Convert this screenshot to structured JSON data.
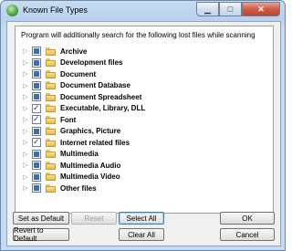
{
  "window": {
    "title": "Known File Types",
    "controls": [
      "minimize-icon",
      "maximize-icon",
      "close-icon"
    ]
  },
  "panel": {
    "description": "Program will additionally search for the following lost files while scanning"
  },
  "tree": {
    "items": [
      {
        "label": "Archive",
        "state": "partial"
      },
      {
        "label": "Development files",
        "state": "partial"
      },
      {
        "label": "Document",
        "state": "partial"
      },
      {
        "label": "Document Database",
        "state": "partial"
      },
      {
        "label": "Document Spreadsheet",
        "state": "partial"
      },
      {
        "label": "Executable, Library, DLL",
        "state": "checked"
      },
      {
        "label": "Font",
        "state": "checked"
      },
      {
        "label": "Graphics, Picture",
        "state": "partial"
      },
      {
        "label": "Internet related files",
        "state": "checked"
      },
      {
        "label": "Multimedia",
        "state": "partial"
      },
      {
        "label": "Multimedia Audio",
        "state": "partial"
      },
      {
        "label": "Multimedia Video",
        "state": "partial"
      },
      {
        "label": "Other files",
        "state": "partial"
      }
    ]
  },
  "buttons": {
    "set_default": "Set as Default",
    "reset": "Reset",
    "select_all": "Select All",
    "ok": "OK",
    "revert": "Revert to Default",
    "clear_all": "Clear All",
    "cancel": "Cancel"
  },
  "colors": {
    "accent": "#3d6fb0",
    "folder": "#f0c95a",
    "titlebar": "#c4d8f0"
  }
}
